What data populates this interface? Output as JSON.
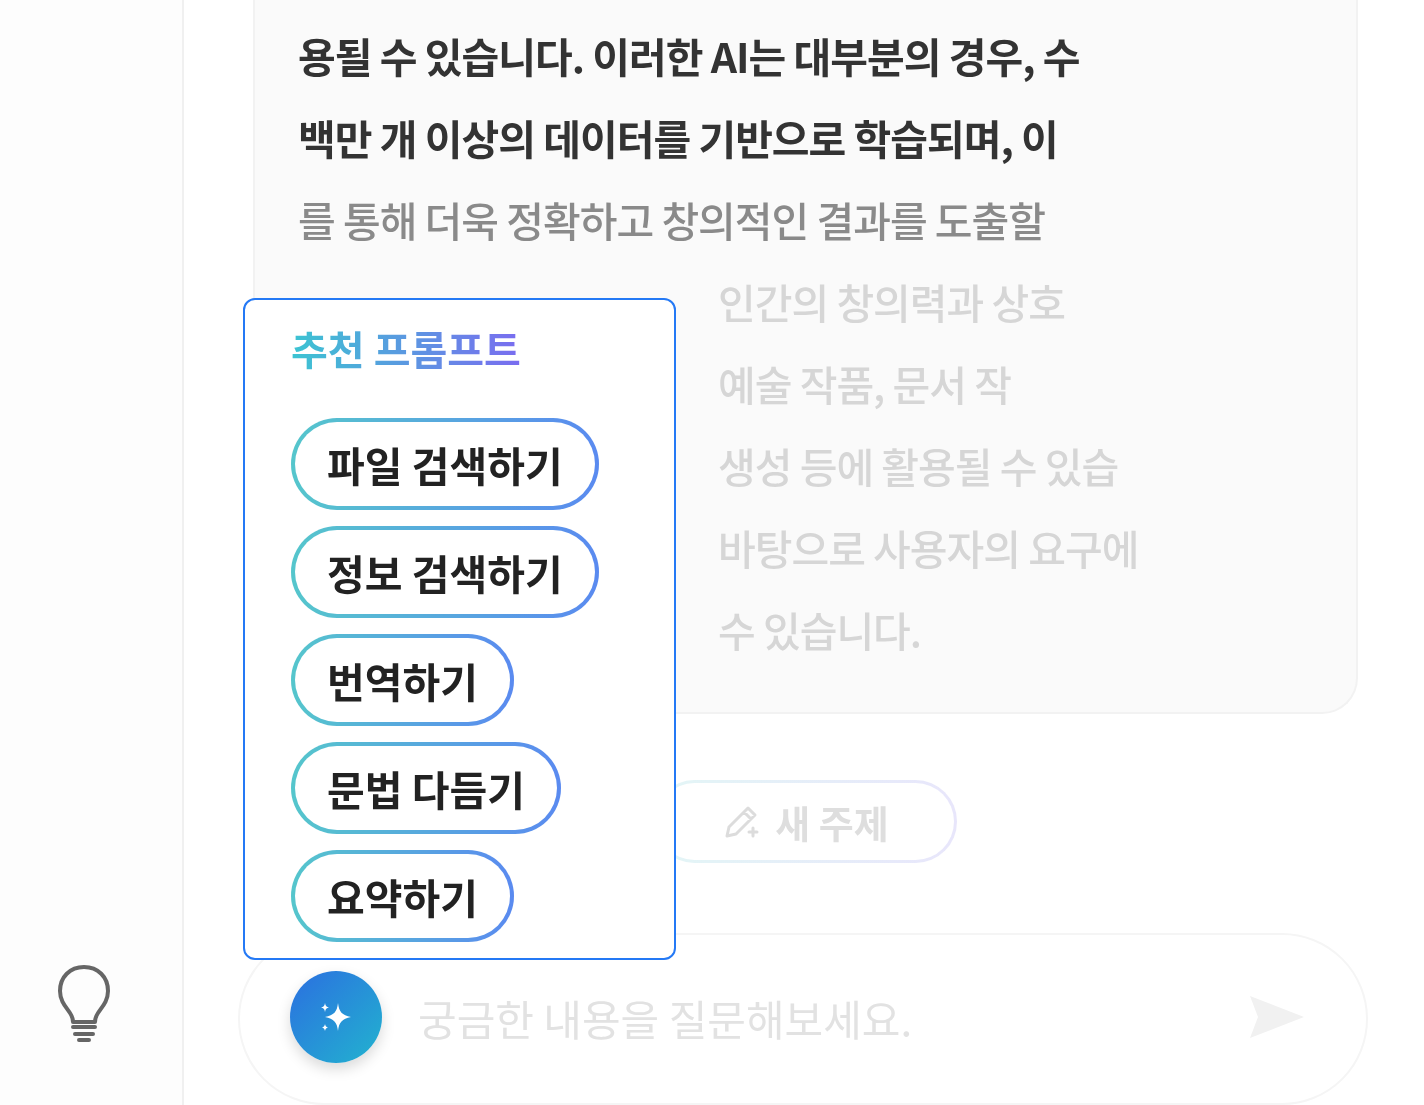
{
  "message": {
    "lines": [
      {
        "text": "용될 수 있습니다. 이러한 AI는 대부분의 경우, 수",
        "bold": true,
        "faded": false,
        "kind": "full"
      },
      {
        "text": "백만 개 이상의 데이터를 기반으로 학습되며, 이",
        "bold": true,
        "faded": false,
        "kind": "full"
      },
      {
        "text": "를 통해 더욱 정확하고 창의적인 결과를 도출할",
        "bold": false,
        "faded": false,
        "kind": "full"
      },
      {
        "text": "인간의 창의력과 상호",
        "bold": false,
        "faded": true,
        "kind": "partial"
      },
      {
        "text": "예술 작품, 문서 작",
        "bold": false,
        "faded": true,
        "kind": "partial"
      },
      {
        "text": "생성 등에 활용될 수 있습",
        "bold": false,
        "faded": true,
        "kind": "partial"
      },
      {
        "text": "바탕으로 사용자의 요구에",
        "bold": false,
        "faded": true,
        "kind": "partial"
      },
      {
        "text": "수 있습니다.",
        "bold": false,
        "faded": true,
        "kind": "partial"
      }
    ]
  },
  "new_topic_button": {
    "label": "새 주제"
  },
  "input": {
    "placeholder": "궁금한 내용을 질문해보세요."
  },
  "prompt_popup": {
    "title": "추천 프롬프트",
    "prompts": [
      {
        "label": "파일 검색하기"
      },
      {
        "label": "정보 검색하기"
      },
      {
        "label": "번역하기"
      },
      {
        "label": "문법 다듬기"
      },
      {
        "label": "요약하기"
      }
    ]
  }
}
